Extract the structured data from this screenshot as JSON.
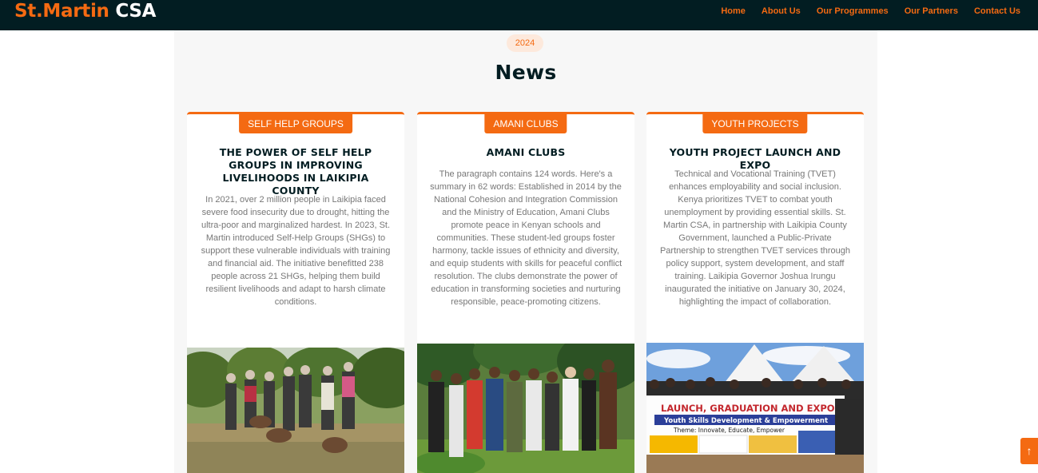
{
  "brand": {
    "part1": "St.Martin",
    "part2": " CSA"
  },
  "nav": [
    "Home",
    "About Us",
    "Our Programmes",
    "Our Partners",
    "Contact Us"
  ],
  "section": {
    "year": "2024",
    "title": "News"
  },
  "cards": [
    {
      "tag": "SELF HELP GROUPS",
      "title": "THE POWER OF SELF HELP GROUPS IN IMPROVING LIVELIHOODS IN LAIKIPIA COUNTY",
      "body": "In 2021, over 2 million people in Laikipia faced severe food insecurity due to drought, hitting the ultra-poor and marginalized hardest. In 2023, St. Martin introduced Self-Help Groups (SHGs) to support these vulnerable individuals with training and financial aid. The initiative benefitted 238 people across 21 SHGs, helping them build resilient livelihoods and adapt to harsh climate conditions."
    },
    {
      "tag": "AMANI CLUBS",
      "title": "AMANI CLUBS",
      "body": "The paragraph contains 124 words. Here's a summary in 62 words: Established in 2014 by the National Cohesion and Integration Commission and the Ministry of Education, Amani Clubs promote peace in Kenyan schools and communities. These student-led groups foster harmony, tackle issues of ethnicity and diversity, and equip students with skills for peaceful conflict resolution. The clubs demonstrate the power of education in transforming societies and nurturing responsible, peace-promoting citizens."
    },
    {
      "tag": "YOUTH PROJECTS",
      "title": "YOUTH PROJECT LAUNCH AND EXPO",
      "body": "Technical and Vocational Training (TVET) enhances employability and social inclusion. Kenya prioritizes TVET to combat youth unemployment by providing essential skills. St. Martin CSA, in partnership with Laikipia County Government, launched a Public-Private Partnership to strengthen TVET services through policy support, system development, and staff training. Laikipia Governor Joshua Irungu inaugurated the initiative on January 30, 2024, highlighting the impact of collaboration.",
      "banner": {
        "line1": "LAUNCH, GRADUATION AND EXPO",
        "line2": "Youth Skills Development & Empowerment",
        "line3": "Theme: Innovate, Educate, Empower"
      }
    }
  ],
  "scroll_top": {
    "icon": "arrow-up-icon",
    "glyph": "↑"
  },
  "colors": {
    "accent": "#f46a12",
    "navbar": "#021d22",
    "section_bg": "#f7f7f7"
  }
}
